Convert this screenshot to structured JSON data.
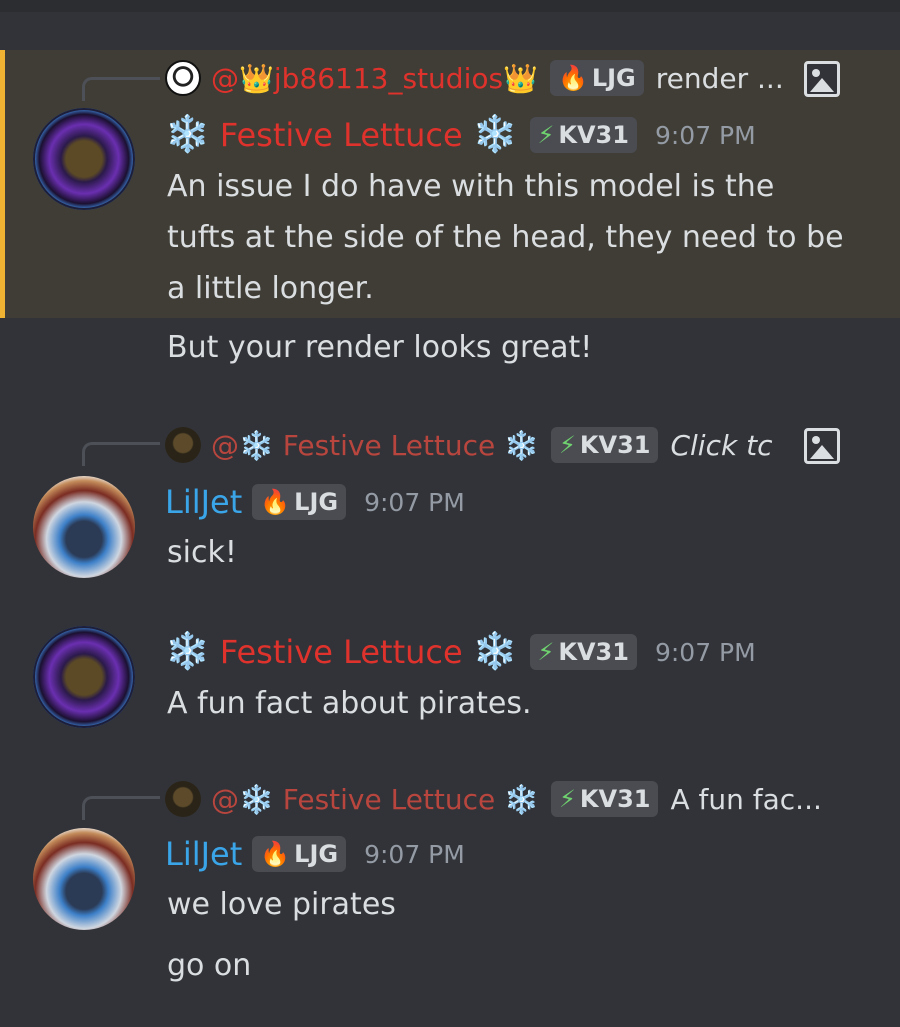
{
  "messages": [
    {
      "reply": {
        "mention": "@👑jb86113_studios👑",
        "tag": "LJG",
        "preview": "render ..."
      },
      "author": {
        "name": "Festive Lettuce",
        "tag": "KV31",
        "time": "9:07 PM"
      },
      "lines": [
        "An issue I do have with this model is the tufts at the side of the head, they need to be a little longer.",
        "But your render looks great!"
      ]
    },
    {
      "reply": {
        "mention": "@❄️ Festive Lettuce ❄️",
        "tag": "KV31",
        "preview": "Click tc"
      },
      "author": {
        "name": "LilJet",
        "tag": "LJG",
        "time": "9:07 PM"
      },
      "lines": [
        "sick!"
      ]
    },
    {
      "author": {
        "name": "Festive Lettuce",
        "tag": "KV31",
        "time": "9:07 PM"
      },
      "lines": [
        "A fun fact about pirates."
      ]
    },
    {
      "reply": {
        "mention": "@❄️ Festive Lettuce ❄️",
        "tag": "KV31",
        "preview": "A fun fac..."
      },
      "author": {
        "name": "LilJet",
        "tag": "LJG",
        "time": "9:07 PM"
      },
      "lines": [
        "we love pirates",
        "go on"
      ]
    }
  ],
  "icons": {
    "snowflake": "❄️",
    "bolt": "⚡",
    "flame": "🔥",
    "image": "image-icon"
  },
  "colors": {
    "mention_red": "#e0322c",
    "liljet_blue": "#3aa5e8",
    "highlight_bar": "#f0b232",
    "background": "#313338"
  }
}
